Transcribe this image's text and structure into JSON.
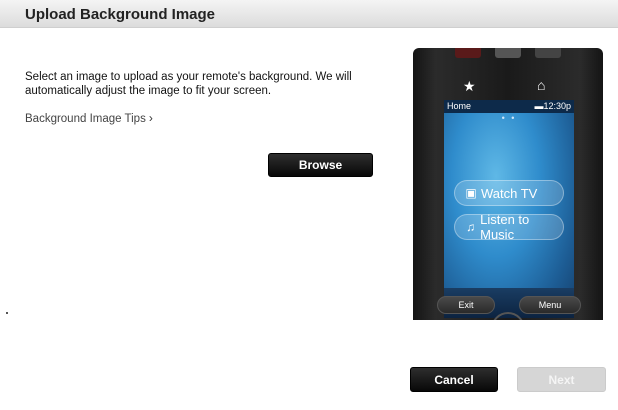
{
  "dialog": {
    "title": "Upload Background Image",
    "intro_text": "Select an image to upload as your remote's background. We will automatically adjust the image to fit your screen.",
    "tips_link": "Background Image Tips",
    "tips_chevron": "›",
    "browse_label": "Browse",
    "cancel_label": "Cancel",
    "next_label": "Next"
  },
  "remote_preview": {
    "star_glyph": "★",
    "home_glyph": "⌂",
    "status_home": "Home",
    "status_time": "▬12:30p",
    "page_dots": "• •",
    "activities": [
      {
        "label": "Watch TV",
        "icon": "tv-icon",
        "glyph": "▣"
      },
      {
        "label": "Listen to Music",
        "icon": "music-note-icon",
        "glyph": "♫"
      }
    ],
    "menu_glyph": "≡",
    "exit_label": "Exit",
    "menu_label": "Menu"
  },
  "colors": {
    "primary_button": "#111111",
    "disabled_button": "#d6d6d6",
    "screen_blue": "#2f8ccc"
  }
}
